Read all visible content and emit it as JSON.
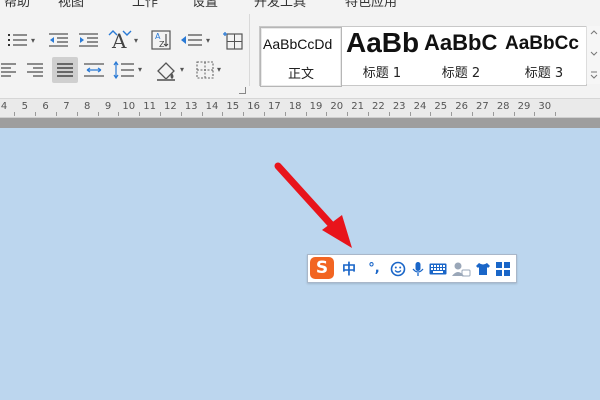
{
  "ribbon": {
    "tabs": [
      "帮助",
      "视图",
      "工作",
      "设置",
      "开发工具",
      "特色应用"
    ]
  },
  "styles": {
    "items": [
      {
        "sample": "AaBbCcDd",
        "name": "正文",
        "active": true
      },
      {
        "sample": "AaBb",
        "name": "标题 1",
        "active": false
      },
      {
        "sample": "AaBbC",
        "name": "标题 2",
        "active": false
      },
      {
        "sample": "AaBbCc",
        "name": "标题 3",
        "active": false
      }
    ]
  },
  "ruler": {
    "numbers": [
      "4",
      "5",
      "6",
      "7",
      "8",
      "9",
      "10",
      "11",
      "12",
      "13",
      "14",
      "15",
      "16",
      "17",
      "18",
      "19",
      "20",
      "21",
      "22",
      "23",
      "24",
      "25",
      "26",
      "27",
      "28",
      "29",
      "30"
    ]
  },
  "ime": {
    "logo": "S",
    "mode": "中",
    "punct": "°,",
    "icons": [
      "emoji-icon",
      "voice-icon",
      "keyboard-icon",
      "user-icon",
      "skin-icon",
      "toolbox-icon"
    ],
    "accent": "#f26522",
    "icon_color": "#1a66c8"
  },
  "colors": {
    "page_background": "#bcd6ee",
    "ribbon_background": "#f3f3f3",
    "arrow": "#e8141b"
  }
}
